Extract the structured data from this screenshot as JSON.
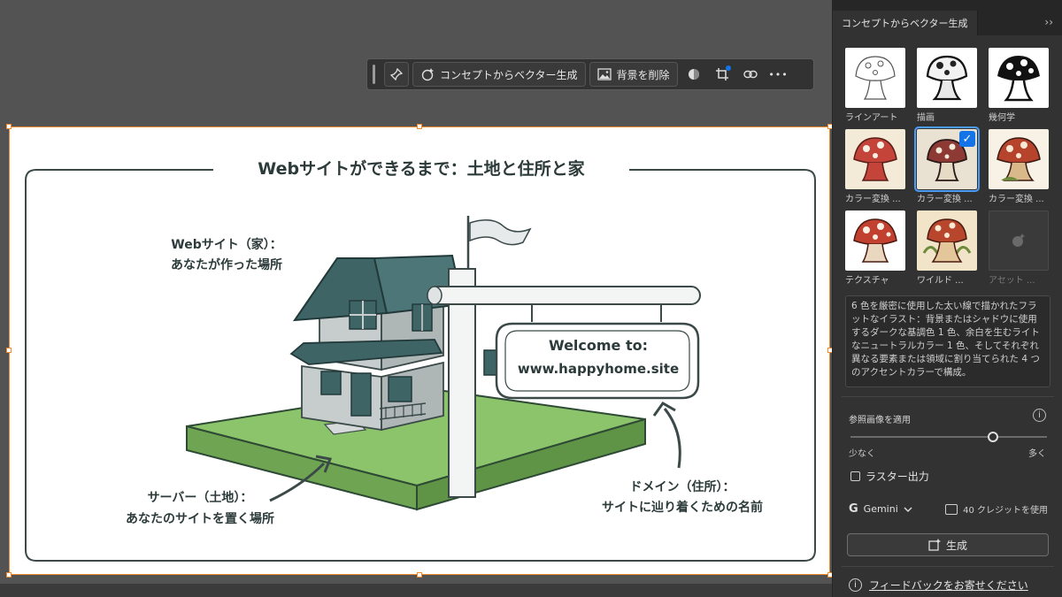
{
  "taskbar": {
    "concept_label": "コンセプトからベクター生成",
    "remove_bg_label": "背景を削除",
    "more_label": "•••"
  },
  "panel": {
    "tab_title": "コンセプトからベクター生成",
    "collapse": "››",
    "styles": [
      {
        "label": "ラインアート",
        "selected": false,
        "disabled": false
      },
      {
        "label": "描画",
        "selected": false,
        "disabled": false
      },
      {
        "label": "幾何学",
        "selected": false,
        "disabled": false
      },
      {
        "label": "カラー変換 ...",
        "selected": false,
        "disabled": false
      },
      {
        "label": "カラー変換 ...",
        "selected": true,
        "disabled": false
      },
      {
        "label": "カラー変換 ...",
        "selected": false,
        "disabled": false
      },
      {
        "label": "テクスチャ",
        "selected": false,
        "disabled": false
      },
      {
        "label": "ワイルド ...",
        "selected": false,
        "disabled": false
      },
      {
        "label": "アセット ...",
        "selected": false,
        "disabled": true
      }
    ],
    "prompt": "6 色を厳密に使用した太い線で描かれたフラットなイラスト：背景またはシャドウに使用するダークな基調色 1 色、余白を生むライトなニュートラルカラー 1 色、そしてそれぞれ異なる要素または領域に割り当てられた 4 つのアクセントカラーで構成。",
    "reference": {
      "label": "参照画像を適用",
      "info": "i",
      "min_label": "少なく",
      "max_label": "多く",
      "level": 0.74
    },
    "raster_label": "ラスター出力",
    "model_name": "Gemini",
    "credits_label": "40 クレジットを使用",
    "generate_label": "生成",
    "feedback_label": "フィードバックをお寄せください"
  },
  "artwork": {
    "title": "Webサイトができるまで：土地と住所と家",
    "website_line1": "Webサイト（家）：",
    "website_line2": "あなたが作った場所",
    "server_line1": "サーバー（土地）：",
    "server_line2": "あなたのサイトを置く場所",
    "domain_line1": "ドメイン（住所）：",
    "domain_line2": "サイトに辿り着くための名前",
    "sign_line1": "Welcome to:",
    "sign_line2": "www.happyhome.site"
  },
  "colors": {
    "accent": "#1473e6",
    "selection": "#f0892b",
    "roof": "#3e6466",
    "grass": "#8cc46b",
    "ink": "#2c3b3a"
  }
}
